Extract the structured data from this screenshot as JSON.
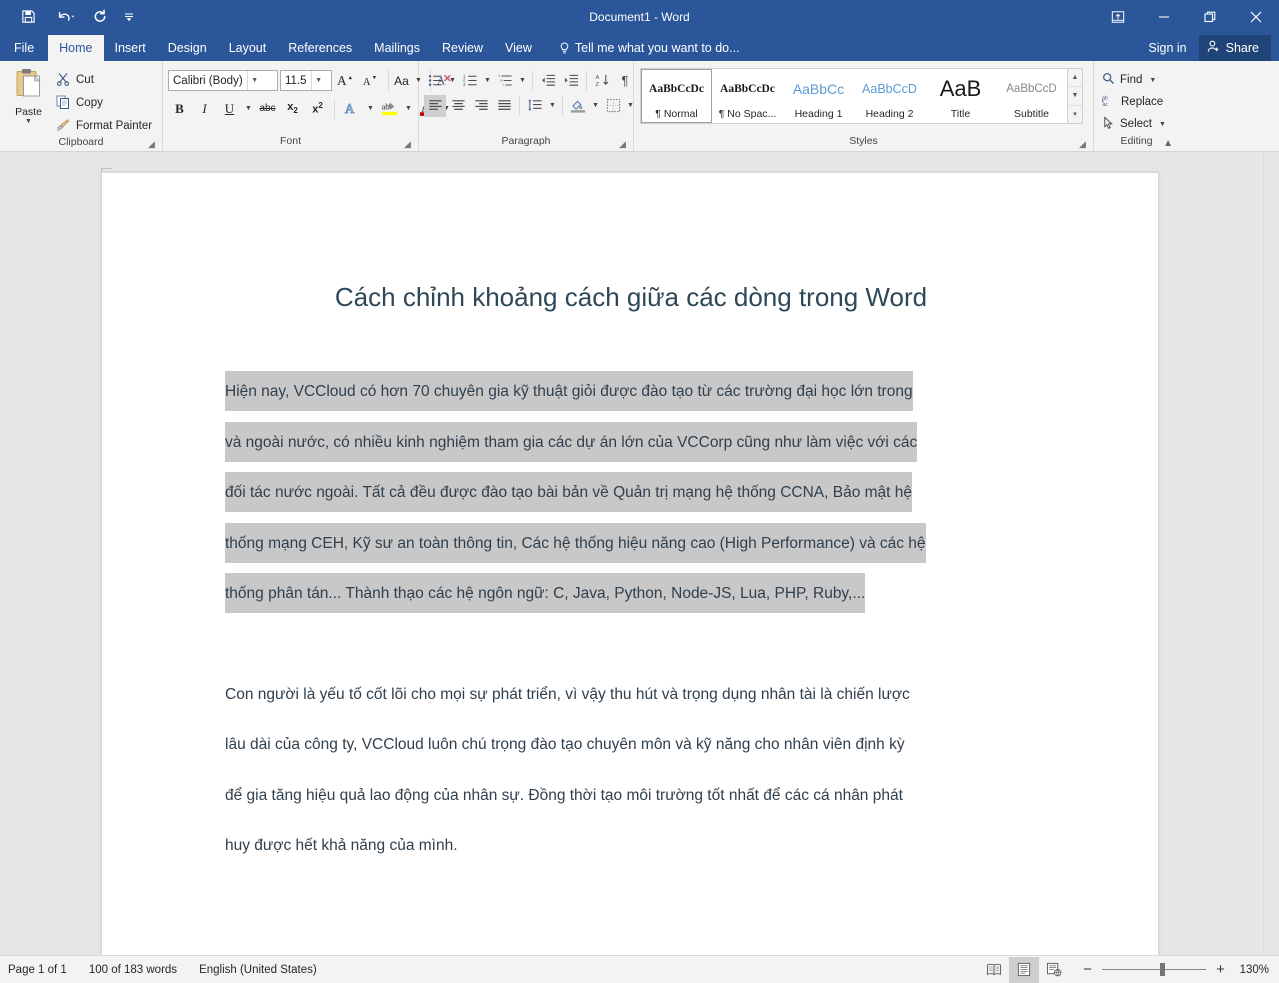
{
  "window": {
    "title": "Document1 - Word",
    "quick_access": [
      {
        "name": "save-icon",
        "label": "Save"
      },
      {
        "name": "undo-icon",
        "label": "Undo"
      },
      {
        "name": "redo-icon",
        "label": "Redo"
      },
      {
        "name": "customize-qat-icon",
        "label": "Customize Quick Access Toolbar"
      }
    ],
    "controls": [
      {
        "name": "ribbon-display-options-icon",
        "label": "Ribbon Display Options"
      },
      {
        "name": "minimize-icon",
        "label": "Minimize"
      },
      {
        "name": "restore-icon",
        "label": "Restore Down"
      },
      {
        "name": "close-icon",
        "label": "Close"
      }
    ],
    "accent_color": "#2b579a",
    "tab_active_bg": "#f3f3f3"
  },
  "tabs": [
    {
      "label": "File",
      "active": false
    },
    {
      "label": "Home",
      "active": true
    },
    {
      "label": "Insert",
      "active": false
    },
    {
      "label": "Design",
      "active": false
    },
    {
      "label": "Layout",
      "active": false
    },
    {
      "label": "References",
      "active": false
    },
    {
      "label": "Mailings",
      "active": false
    },
    {
      "label": "Review",
      "active": false
    },
    {
      "label": "View",
      "active": false
    }
  ],
  "tellme": {
    "label": "Tell me what you want to do...",
    "icon": "lightbulb-icon"
  },
  "account": {
    "signin": "Sign in",
    "share": "Share",
    "share_icon": "share-person-icon"
  },
  "ribbon": {
    "clipboard": {
      "label": "Clipboard",
      "paste": "Paste",
      "commands": [
        {
          "label": "Cut",
          "icon": "scissors-icon"
        },
        {
          "label": "Copy",
          "icon": "copy-icon"
        },
        {
          "label": "Format Painter",
          "icon": "format-painter-icon"
        }
      ]
    },
    "font": {
      "label": "Font",
      "font_name": "Calibri (Body)",
      "font_size": "11.5",
      "buttons_row1": [
        {
          "name": "grow-font-button",
          "glyph": "A˄"
        },
        {
          "name": "shrink-font-button",
          "glyph": "A˅"
        },
        {
          "name": "change-case-button",
          "glyph": "Aa"
        },
        {
          "name": "clear-formatting-button",
          "glyph": "clear-format-icon"
        }
      ],
      "buttons_row2": [
        {
          "name": "bold-button",
          "glyph": "B"
        },
        {
          "name": "italic-button",
          "glyph": "I"
        },
        {
          "name": "underline-button",
          "glyph": "U"
        },
        {
          "name": "strikethrough-button",
          "glyph": "abc"
        },
        {
          "name": "subscript-button",
          "glyph": "x₂"
        },
        {
          "name": "superscript-button",
          "glyph": "x²"
        },
        {
          "name": "text-effects-button",
          "glyph": "A"
        },
        {
          "name": "text-highlight-color-button",
          "glyph": "ab"
        },
        {
          "name": "font-color-button",
          "glyph": "A"
        }
      ]
    },
    "paragraph": {
      "label": "Paragraph",
      "row1": [
        {
          "name": "bullets-button"
        },
        {
          "name": "numbering-button"
        },
        {
          "name": "multilevel-list-button"
        },
        {
          "name": "decrease-indent-button"
        },
        {
          "name": "increase-indent-button"
        },
        {
          "name": "sort-button"
        },
        {
          "name": "show-formatting-marks-button"
        }
      ],
      "row2": [
        {
          "name": "align-left-button",
          "active": true
        },
        {
          "name": "align-center-button",
          "active": false
        },
        {
          "name": "align-right-button",
          "active": false
        },
        {
          "name": "justify-button",
          "active": false
        },
        {
          "name": "line-spacing-button",
          "active": false
        },
        {
          "name": "shading-button",
          "active": false
        },
        {
          "name": "borders-button",
          "active": false
        }
      ]
    },
    "styles": {
      "label": "Styles",
      "items": [
        {
          "preview": "AaBbCcDc",
          "name": "¶ Normal",
          "selected": true,
          "style": "normal"
        },
        {
          "preview": "AaBbCcDc",
          "name": "¶ No Spac...",
          "selected": false,
          "style": "nospacing"
        },
        {
          "preview": "AaBbCc",
          "name": "Heading 1",
          "selected": false,
          "style": "heading1"
        },
        {
          "preview": "AaBbCcD",
          "name": "Heading 2",
          "selected": false,
          "style": "heading2"
        },
        {
          "preview": "AaB",
          "name": "Title",
          "selected": false,
          "style": "title"
        },
        {
          "preview": "AaBbCcD",
          "name": "Subtitle",
          "selected": false,
          "style": "subtitle"
        }
      ]
    },
    "editing": {
      "label": "Editing",
      "commands": [
        {
          "label": "Find",
          "icon": "magnifier-icon",
          "caret": true
        },
        {
          "label": "Replace",
          "icon": "replace-icon",
          "caret": false
        },
        {
          "label": "Select",
          "icon": "cursor-arrow-icon",
          "caret": true
        }
      ]
    }
  },
  "document": {
    "title": "Cách chỉnh khoảng cách giữa các dòng trong Word",
    "selection_color": "#c8c8c8",
    "paragraph1_lines": [
      "Hiện nay, VCCloud có hơn 70 chuyên gia kỹ thuật giỏi được đào tạo từ các trường đại học lớn trong",
      "và ngoài nước, có nhiều kinh nghiệm tham gia các dự án lớn của VCCorp cũng như làm việc với các",
      "đối tác nước ngoài. Tất cả đều được đào tạo bài bản về Quản trị mạng hệ thống CCNA, Bảo mật hệ",
      "thống mạng CEH, Kỹ sư an toàn thông tin, Các hệ thống hiệu năng cao (High Performance) và các hệ",
      "thống phân tán... Thành thạo các hệ ngôn ngữ: C, Java, Python, Node-JS, Lua, PHP, Ruby,..."
    ],
    "paragraph2_lines": [
      "Con người là yếu tố cốt lõi cho mọi sự phát triển, vì vậy thu hút và trọng dụng nhân tài là chiến lược",
      "lâu dài của công ty, VCCloud luôn chú trọng đào tạo chuyên môn và kỹ năng cho nhân viên định kỳ",
      "để gia tăng hiệu quả lao động của nhân sự. Đồng thời tạo môi trường tốt nhất để các cá nhân phát",
      "huy được hết khả năng của mình."
    ]
  },
  "statusbar": {
    "page": "Page 1 of 1",
    "words": "100 of 183 words",
    "language": "English (United States)",
    "views": [
      {
        "name": "read-mode-button",
        "label": "Read Mode",
        "active": false
      },
      {
        "name": "print-layout-button",
        "label": "Print Layout",
        "active": true
      },
      {
        "name": "web-layout-button",
        "label": "Web Layout",
        "active": false
      }
    ],
    "zoom_out": "−",
    "zoom_in": "+",
    "zoom_level": "130%"
  }
}
